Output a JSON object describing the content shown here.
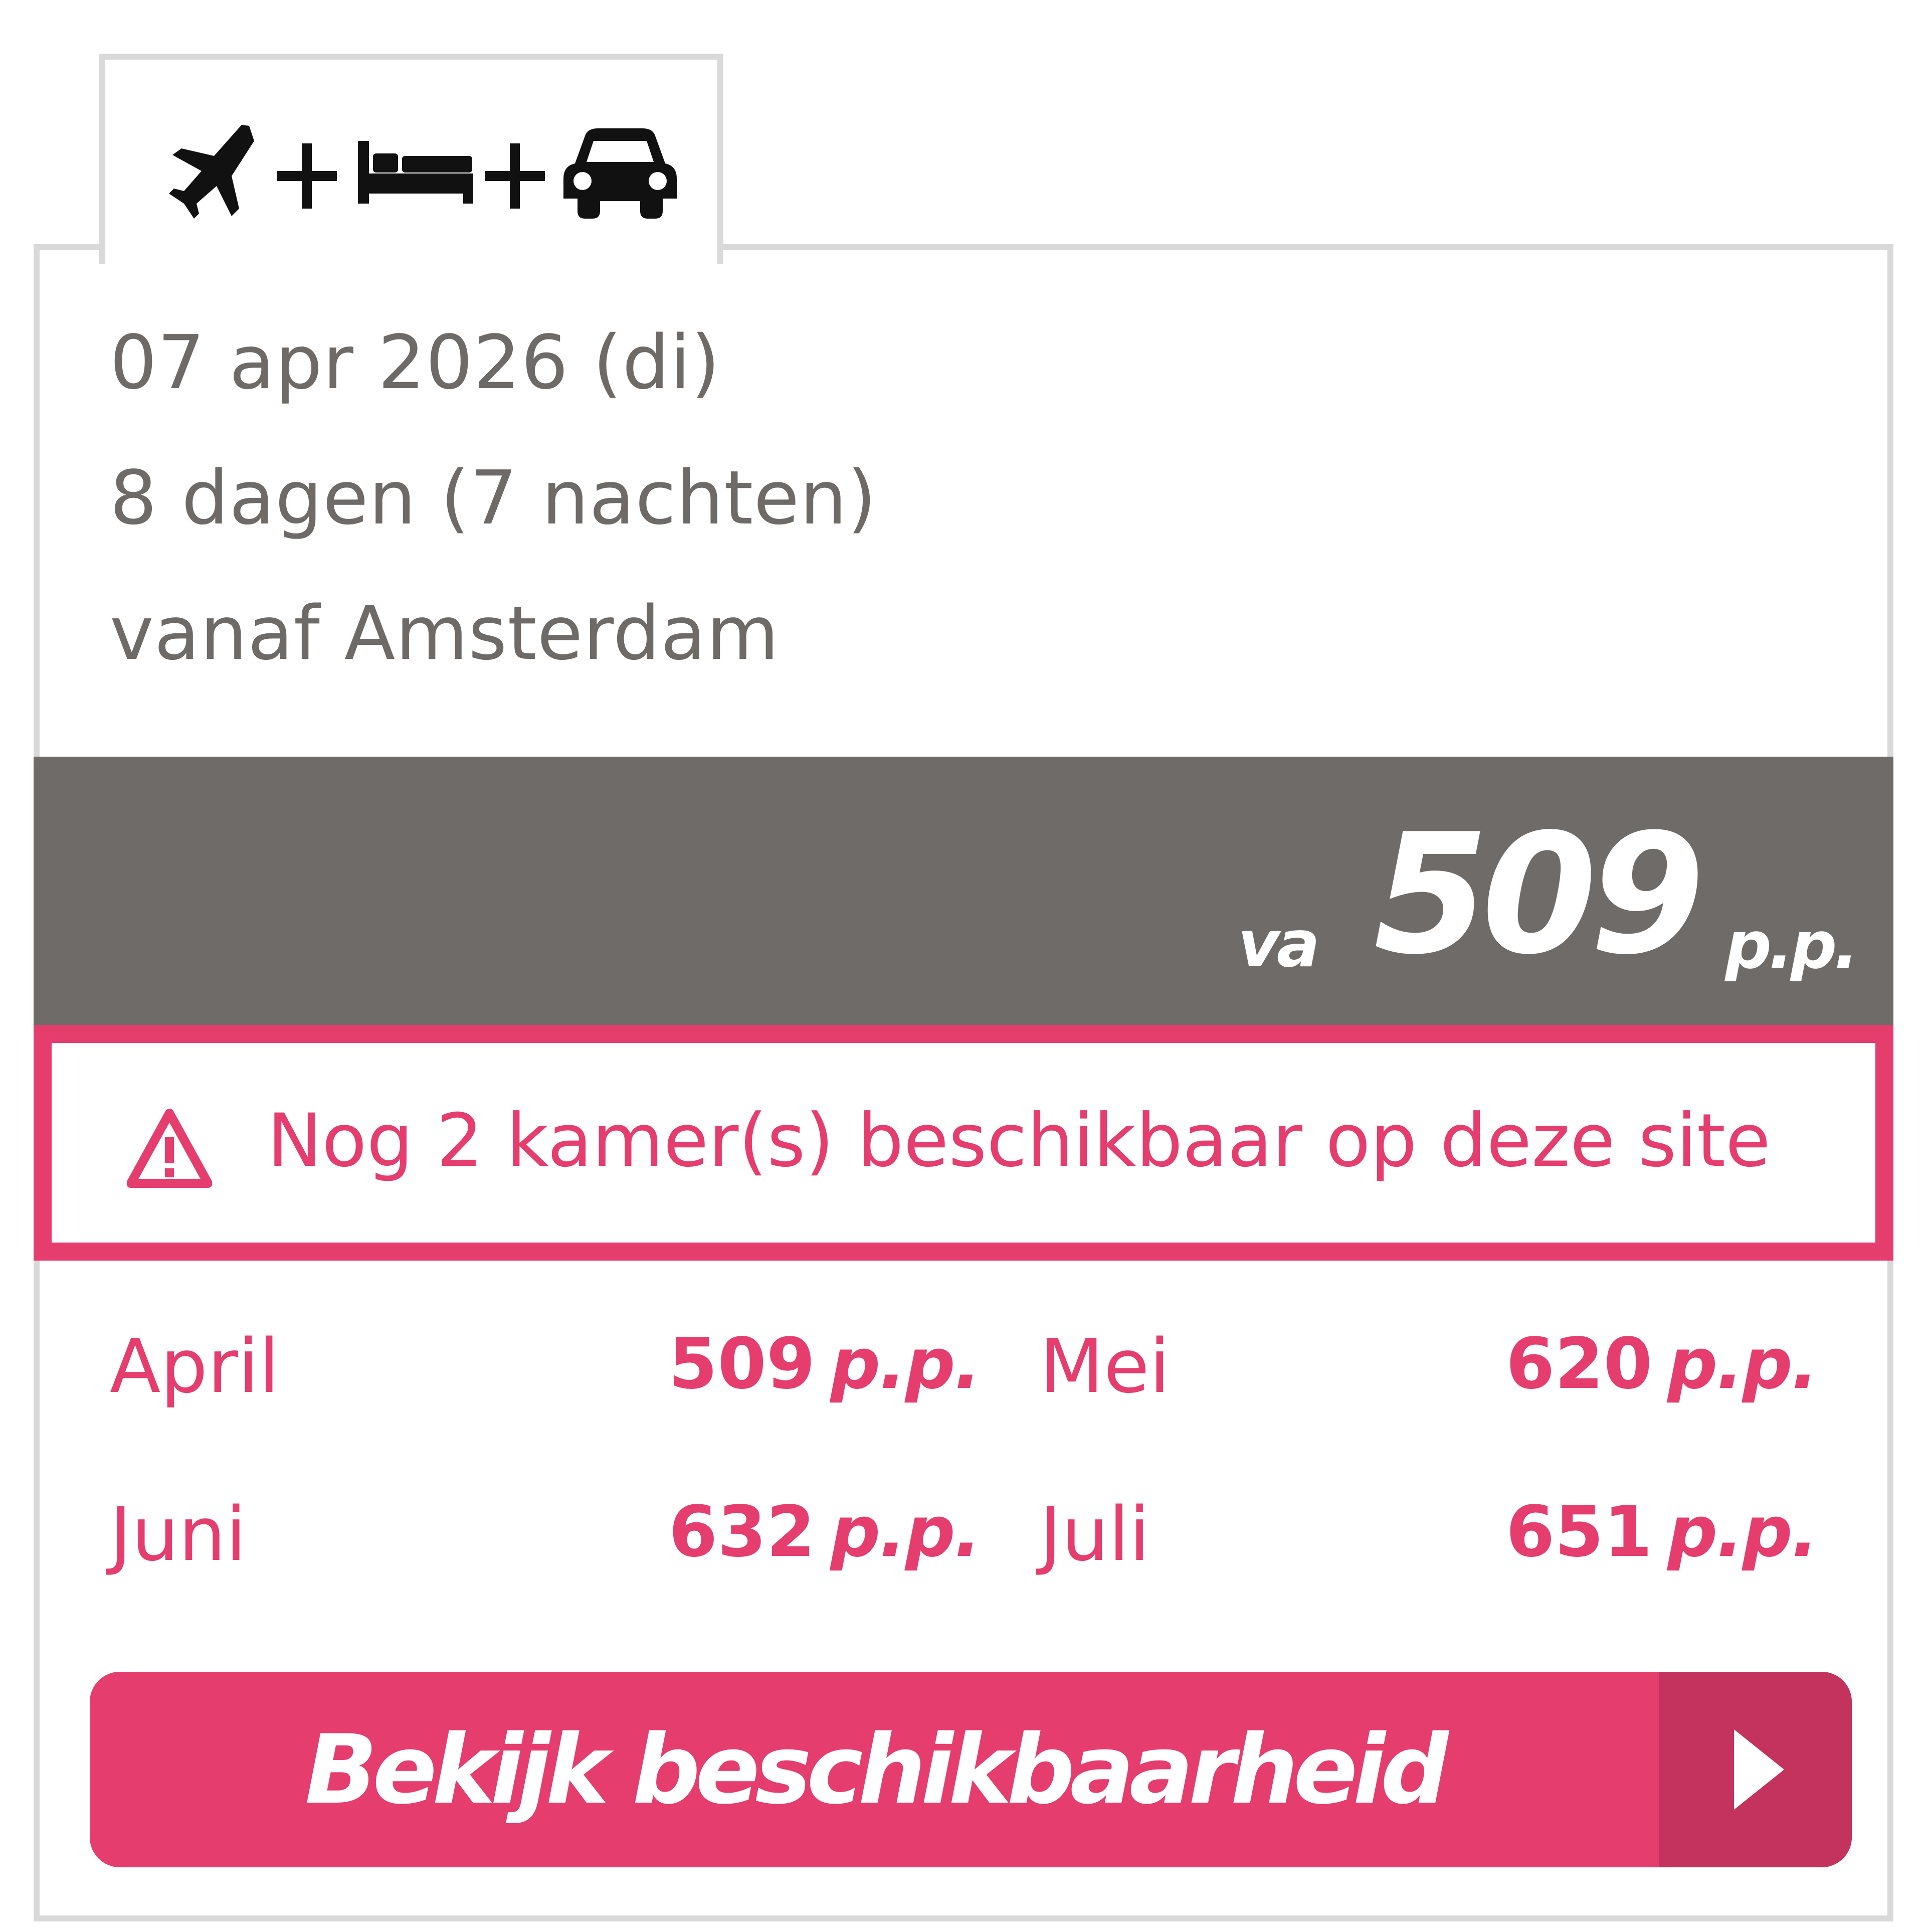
{
  "tab": {
    "icons": [
      "plane-icon",
      "plus-icon",
      "bed-icon",
      "plus-icon",
      "car-icon"
    ]
  },
  "trip": {
    "date": "07 apr 2026 (di)",
    "duration": "8 dagen (7 nachten)",
    "departure": "vanaf Amsterdam"
  },
  "price": {
    "prefix": "va",
    "amount": "509",
    "unit": "p.p."
  },
  "availability": {
    "icon": "warning-icon",
    "text": "Nog 2 kamer(s) beschikbaar op deze site"
  },
  "months": [
    {
      "month": "April",
      "price": "509",
      "unit": "p.p."
    },
    {
      "month": "Mei",
      "price": "620",
      "unit": "p.p."
    },
    {
      "month": "Juni",
      "price": "632",
      "unit": "p.p."
    },
    {
      "month": "Juli",
      "price": "651",
      "unit": "p.p."
    }
  ],
  "cta": {
    "label": "Bekijk beschikbaarheid",
    "icon": "play-arrow-icon"
  },
  "colors": {
    "accent": "#e43d6e",
    "accent_dark": "#c3335d",
    "price_bar": "#6f6b69",
    "text_gray": "#6d6a68",
    "border": "#d9d9d9"
  }
}
